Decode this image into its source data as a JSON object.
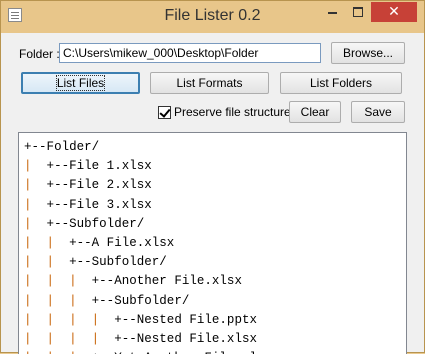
{
  "window": {
    "title": "File Lister 0.2",
    "close_glyph": "✕"
  },
  "folder": {
    "label": "Folder :",
    "path": "C:\\Users\\mikew_000\\Desktop\\Folder"
  },
  "buttons": {
    "browse": "Browse...",
    "list_files": "List Files",
    "list_formats": "List Formats",
    "list_folders": "List Folders",
    "clear": "Clear",
    "save": "Save"
  },
  "preserve": {
    "label": "Preserve file structure",
    "checked": true
  },
  "output": {
    "lines": [
      "+--Folder/",
      "|  +--File 1.xlsx",
      "|  +--File 2.xlsx",
      "|  +--File 3.xlsx",
      "|  +--Subfolder/",
      "|  |  +--A File.xlsx",
      "|  |  +--Subfolder/",
      "|  |  |  +--Another File.xlsx",
      "|  |  |  +--Subfolder/",
      "|  |  |  |  +--Nested File.pptx",
      "|  |  |  |  +--Nested File.xlsx",
      "|  |  |  +--Yet Another File.xlsx"
    ]
  },
  "colors": {
    "titlebar": "#e8c68a",
    "close_button": "#c74137",
    "tree_pipe": "#c8650a",
    "focus_border": "#3c7fb1"
  }
}
